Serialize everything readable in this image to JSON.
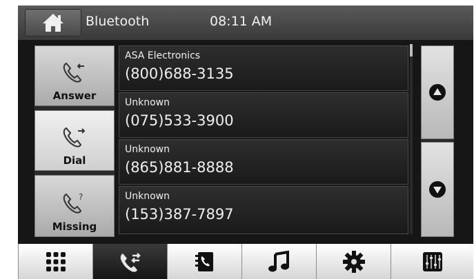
{
  "header": {
    "title": "Bluetooth",
    "time": "08:11 AM"
  },
  "side_buttons": [
    {
      "label": "Answer",
      "icon": "phone-incoming-icon",
      "active": false
    },
    {
      "label": "Dial",
      "icon": "phone-outgoing-icon",
      "active": true
    },
    {
      "label": "Missing",
      "icon": "phone-missed-icon",
      "active": false
    }
  ],
  "calls": [
    {
      "name": "ASA Electronics",
      "number": "(800)688-3135"
    },
    {
      "name": "Unknown",
      "number": "(075)533-3900"
    },
    {
      "name": "Unknown",
      "number": "(865)881-8888"
    },
    {
      "name": "Unknown",
      "number": "(153)387-7897"
    }
  ],
  "scroll_buttons": [
    "up-arrow-icon",
    "down-arrow-icon"
  ],
  "bottom_bar": [
    {
      "icon": "keypad-icon",
      "active": false
    },
    {
      "icon": "call-log-icon",
      "active": true
    },
    {
      "icon": "phonebook-icon",
      "active": false
    },
    {
      "icon": "music-icon",
      "active": false
    },
    {
      "icon": "settings-gear-icon",
      "active": false
    },
    {
      "icon": "equalizer-icon",
      "active": false
    }
  ],
  "colors": {
    "background": "#1c1c1c",
    "button_light": "#d8d8d8",
    "button_active": "#151515",
    "text": "#f0f0f0"
  }
}
